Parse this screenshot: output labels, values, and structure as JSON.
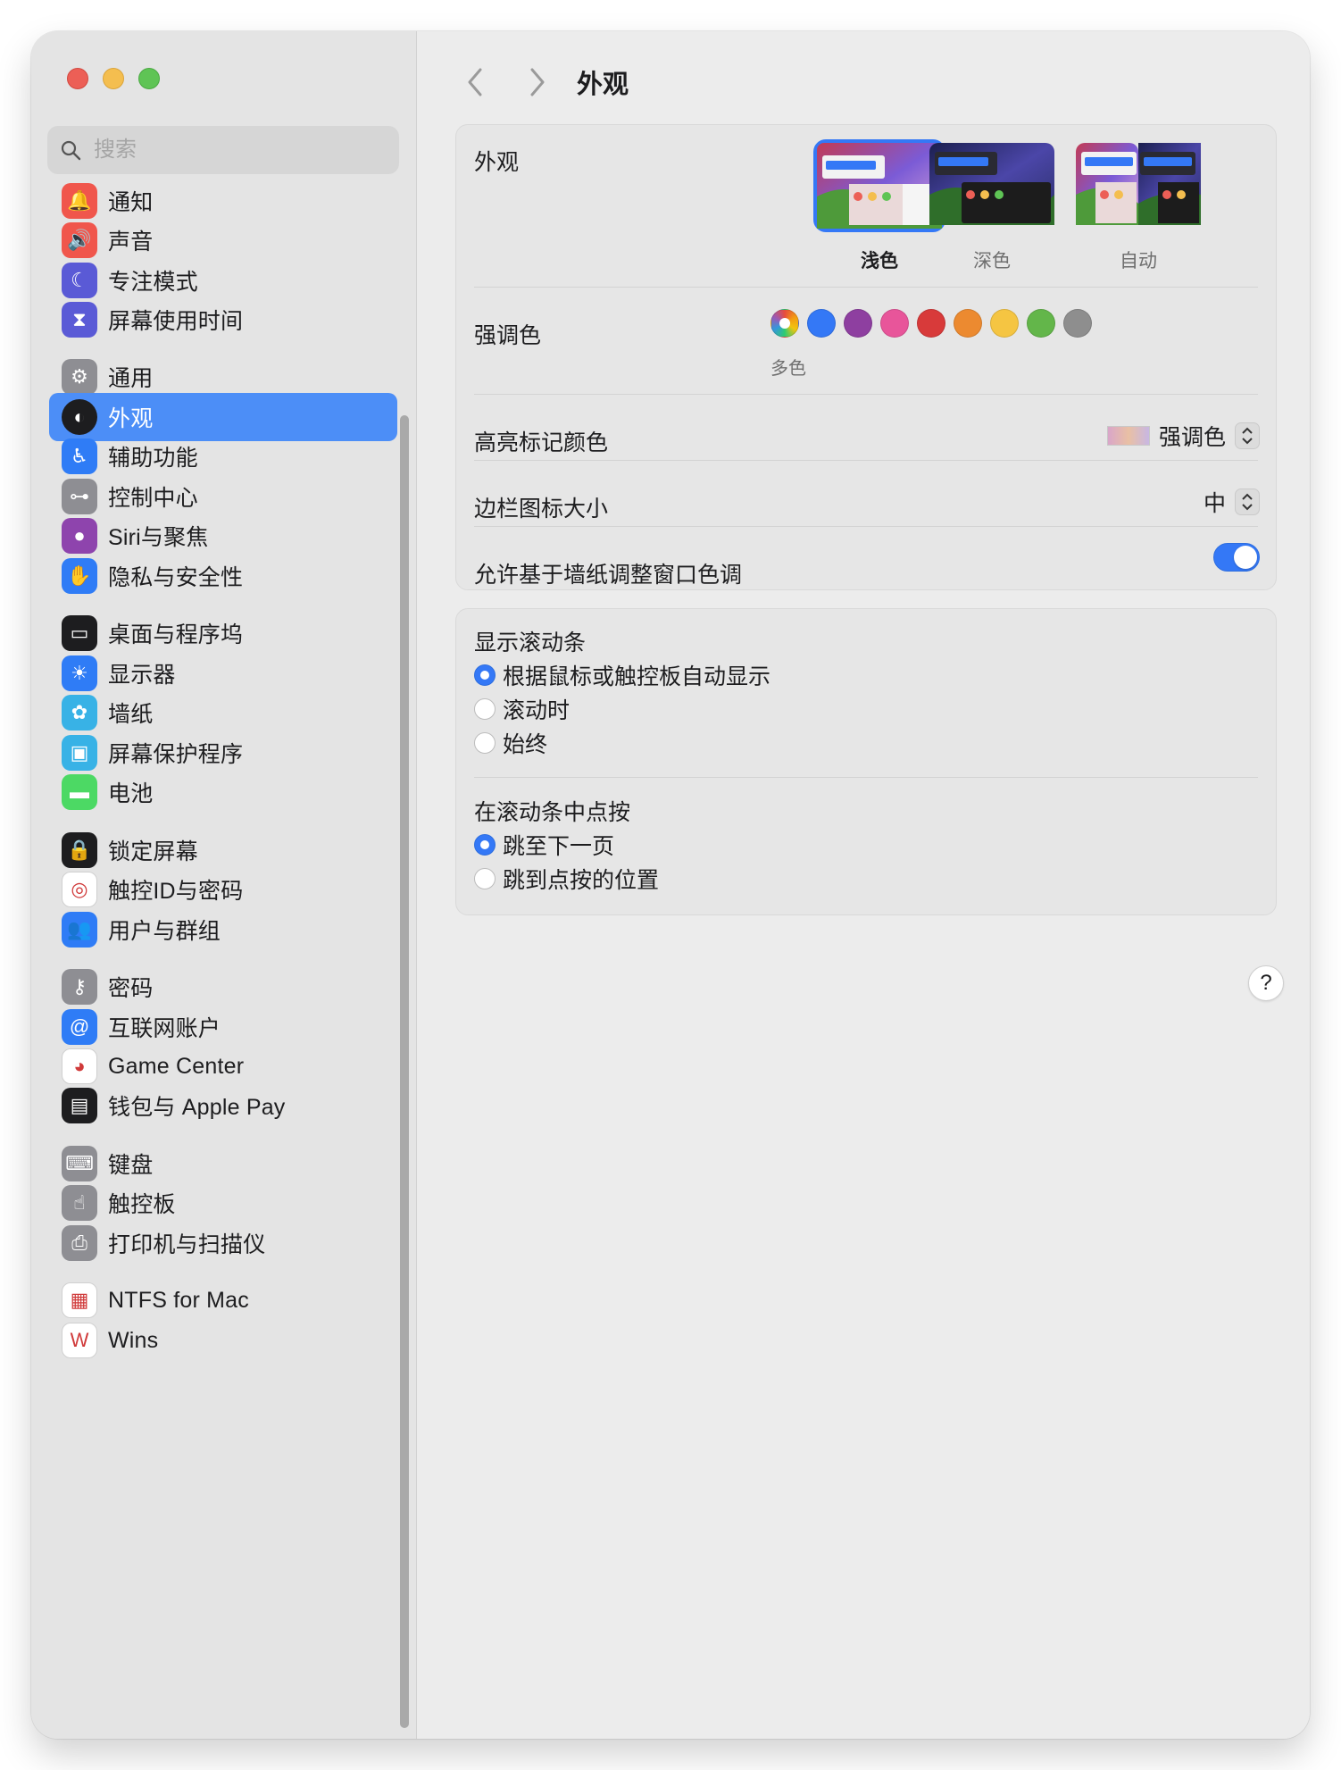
{
  "search": {
    "placeholder": "搜索"
  },
  "sidebar": {
    "items": [
      {
        "label": "通知",
        "name": "notifications",
        "icon": "bell-icon",
        "color": "#f0564c"
      },
      {
        "label": "声音",
        "name": "sound",
        "icon": "speaker-icon",
        "color": "#f0564c"
      },
      {
        "label": "专注模式",
        "name": "focus",
        "icon": "moon-icon",
        "color": "#5a5ad6"
      },
      {
        "label": "屏幕使用时间",
        "name": "screen-time",
        "icon": "hourglass-icon",
        "color": "#5a5ad6"
      },
      {
        "label": "通用",
        "name": "general",
        "icon": "gear-icon",
        "color": "#8e8e93"
      },
      {
        "label": "外观",
        "name": "appearance",
        "icon": "appearance-icon",
        "color": "#1d1d1f",
        "selected": true
      },
      {
        "label": "辅助功能",
        "name": "accessibility",
        "icon": "accessibility-icon",
        "color": "#2f7cf6"
      },
      {
        "label": "控制中心",
        "name": "control-center",
        "icon": "toggles-icon",
        "color": "#8e8e93"
      },
      {
        "label": "Siri与聚焦",
        "name": "siri",
        "icon": "siri-icon",
        "color": "#8e44ad"
      },
      {
        "label": "隐私与安全性",
        "name": "privacy",
        "icon": "hand-icon",
        "color": "#2f7cf6"
      },
      {
        "label": "桌面与程序坞",
        "name": "desktop-dock",
        "icon": "dock-icon",
        "color": "#1d1d1f"
      },
      {
        "label": "显示器",
        "name": "displays",
        "icon": "sun-icon",
        "color": "#2f7cf6"
      },
      {
        "label": "墙纸",
        "name": "wallpaper",
        "icon": "flower-icon",
        "color": "#38b2e6"
      },
      {
        "label": "屏幕保护程序",
        "name": "screen-saver",
        "icon": "screensaver-icon",
        "color": "#38b2e6"
      },
      {
        "label": "电池",
        "name": "battery",
        "icon": "battery-icon",
        "color": "#4cd964"
      },
      {
        "label": "锁定屏幕",
        "name": "lock-screen",
        "icon": "lock-icon",
        "color": "#1d1d1f"
      },
      {
        "label": "触控ID与密码",
        "name": "touch-id",
        "icon": "fingerprint-icon",
        "color": "#ffffff"
      },
      {
        "label": "用户与群组",
        "name": "users",
        "icon": "users-icon",
        "color": "#2f7cf6"
      },
      {
        "label": "密码",
        "name": "passwords",
        "icon": "key-icon",
        "color": "#8e8e93"
      },
      {
        "label": "互联网账户",
        "name": "internet-accounts",
        "icon": "at-icon",
        "color": "#2f7cf6"
      },
      {
        "label": "Game Center",
        "name": "game-center",
        "icon": "game-center-icon",
        "color": "#ffffff"
      },
      {
        "label": "钱包与 Apple Pay",
        "name": "wallet",
        "icon": "wallet-icon",
        "color": "#1d1d1f"
      },
      {
        "label": "键盘",
        "name": "keyboard",
        "icon": "keyboard-icon",
        "color": "#8e8e93"
      },
      {
        "label": "触控板",
        "name": "trackpad",
        "icon": "trackpad-icon",
        "color": "#8e8e93"
      },
      {
        "label": "打印机与扫描仪",
        "name": "printers",
        "icon": "printer-icon",
        "color": "#8e8e93"
      },
      {
        "label": "NTFS for Mac",
        "name": "ntfs",
        "icon": "ntfs-icon",
        "color": "#ffffff"
      },
      {
        "label": "Wins",
        "name": "wins",
        "icon": "wins-icon",
        "color": "#ffffff"
      }
    ]
  },
  "main": {
    "title": "外观",
    "appearance": {
      "label": "外观",
      "options": [
        {
          "label": "浅色",
          "selected": true
        },
        {
          "label": "深色",
          "selected": false
        },
        {
          "label": "自动",
          "selected": false
        }
      ]
    },
    "accent": {
      "label": "强调色",
      "caption": "多色",
      "colors": [
        "multicolor",
        "#3478f6",
        "#8e3fa0",
        "#e8559a",
        "#d83a3a",
        "#ec8a30",
        "#f5c542",
        "#63b64a",
        "#8e8e8e"
      ]
    },
    "highlight": {
      "label": "高亮标记颜色",
      "value": "强调色"
    },
    "sidebar_icon_size": {
      "label": "边栏图标大小",
      "value": "中"
    },
    "wallpaper_tint": {
      "label": "允许基于墙纸调整窗口色调",
      "enabled": true
    },
    "scrollbars": {
      "label": "显示滚动条",
      "options": [
        {
          "label": "根据鼠标或触控板自动显示",
          "selected": true
        },
        {
          "label": "滚动时",
          "selected": false
        },
        {
          "label": "始终",
          "selected": false
        }
      ]
    },
    "click_scroll": {
      "label": "在滚动条中点按",
      "options": [
        {
          "label": "跳至下一页",
          "selected": true
        },
        {
          "label": "跳到点按的位置",
          "selected": false
        }
      ]
    },
    "help": "?"
  }
}
